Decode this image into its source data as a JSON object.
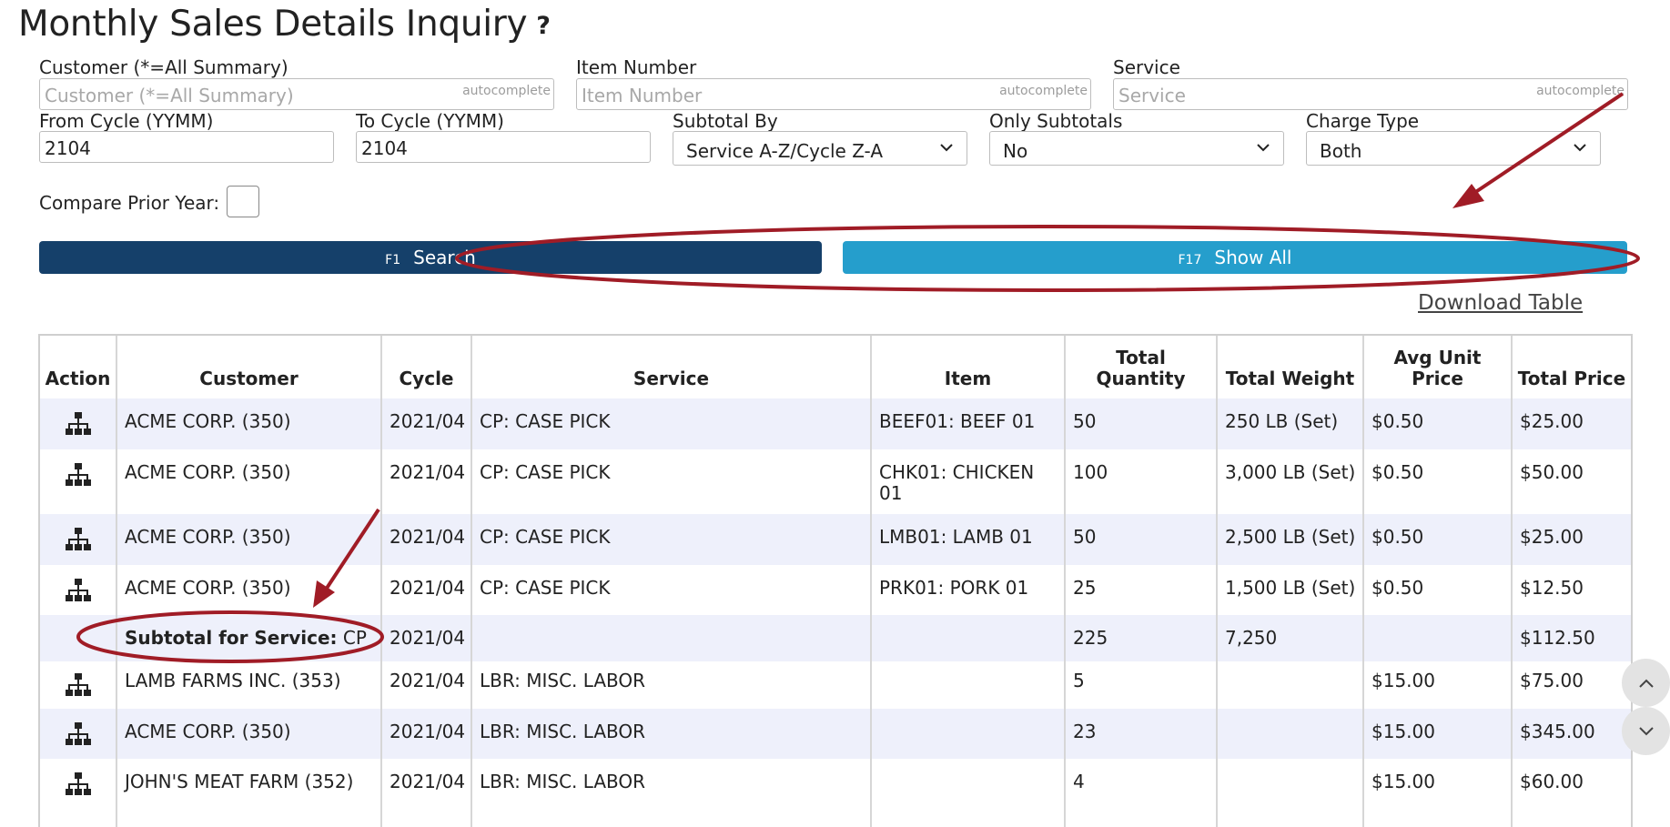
{
  "page": {
    "title": "Monthly Sales Details Inquiry",
    "help_icon": "?"
  },
  "filters": {
    "customer": {
      "label": "Customer (*=All Summary)",
      "placeholder": "Customer (*=All Summary)",
      "tag": "autocomplete"
    },
    "item_number": {
      "label": "Item Number",
      "placeholder": "Item Number",
      "tag": "autocomplete"
    },
    "service": {
      "label": "Service",
      "placeholder": "Service",
      "tag": "autocomplete"
    },
    "from_cycle": {
      "label": "From Cycle (YYMM)",
      "value": "2104"
    },
    "to_cycle": {
      "label": "To Cycle (YYMM)",
      "value": "2104"
    },
    "subtotal_by": {
      "label": "Subtotal By",
      "value": "Service A-Z/Cycle Z-A"
    },
    "only_subtotals": {
      "label": "Only Subtotals",
      "value": "No"
    },
    "charge_type": {
      "label": "Charge Type",
      "value": "Both"
    },
    "compare_prior_year": {
      "label": "Compare Prior Year:"
    }
  },
  "buttons": {
    "search": {
      "key": "F1",
      "label": "Search"
    },
    "show_all": {
      "key": "F17",
      "label": "Show All"
    }
  },
  "download_table": "Download Table",
  "table": {
    "headers": {
      "action": "Action",
      "customer": "Customer",
      "cycle": "Cycle",
      "service": "Service",
      "item": "Item",
      "total_quantity": "Total Quantity",
      "total_weight": "Total Weight",
      "avg_unit_price": "Avg Unit Price",
      "total_price": "Total Price"
    },
    "rows": [
      {
        "customer": "ACME CORP. (350)",
        "cycle": "2021/04",
        "service": "CP: CASE PICK",
        "item": "BEEF01: BEEF 01",
        "qty": "50",
        "weight": "250 LB (Set)",
        "avg": "$0.50",
        "total": "$25.00"
      },
      {
        "customer": "ACME CORP. (350)",
        "cycle": "2021/04",
        "service": "CP: CASE PICK",
        "item": "CHK01: CHICKEN 01",
        "qty": "100",
        "weight": "3,000 LB (Set)",
        "avg": "$0.50",
        "total": "$50.00"
      },
      {
        "customer": "ACME CORP. (350)",
        "cycle": "2021/04",
        "service": "CP: CASE PICK",
        "item": "LMB01: LAMB 01",
        "qty": "50",
        "weight": "2,500 LB (Set)",
        "avg": "$0.50",
        "total": "$25.00"
      },
      {
        "customer": "ACME CORP. (350)",
        "cycle": "2021/04",
        "service": "CP: CASE PICK",
        "item": "PRK01: PORK 01",
        "qty": "25",
        "weight": "1,500 LB (Set)",
        "avg": "$0.50",
        "total": "$12.50"
      }
    ],
    "subtotal": {
      "label": "Subtotal for Service:",
      "value": "CP",
      "cycle": "2021/04",
      "qty": "225",
      "weight": "7,250",
      "total": "$112.50"
    },
    "rows2": [
      {
        "customer": "LAMB FARMS INC. (353)",
        "cycle": "2021/04",
        "service": "LBR: MISC. LABOR",
        "item": "",
        "qty": "5",
        "weight": "",
        "avg": "$15.00",
        "total": "$75.00"
      },
      {
        "customer": "ACME CORP. (350)",
        "cycle": "2021/04",
        "service": "LBR: MISC. LABOR",
        "item": "",
        "qty": "23",
        "weight": "",
        "avg": "$15.00",
        "total": "$345.00"
      },
      {
        "customer": "JOHN'S MEAT FARM (352)",
        "cycle": "2021/04",
        "service": "LBR: MISC. LABOR",
        "item": "",
        "qty": "4",
        "weight": "",
        "avg": "$15.00",
        "total": "$60.00"
      }
    ]
  },
  "colors": {
    "search_button": "#15406a",
    "show_all_button": "#259ecc",
    "annotation": "#a01c26",
    "row_alt": "#eef0fb"
  }
}
